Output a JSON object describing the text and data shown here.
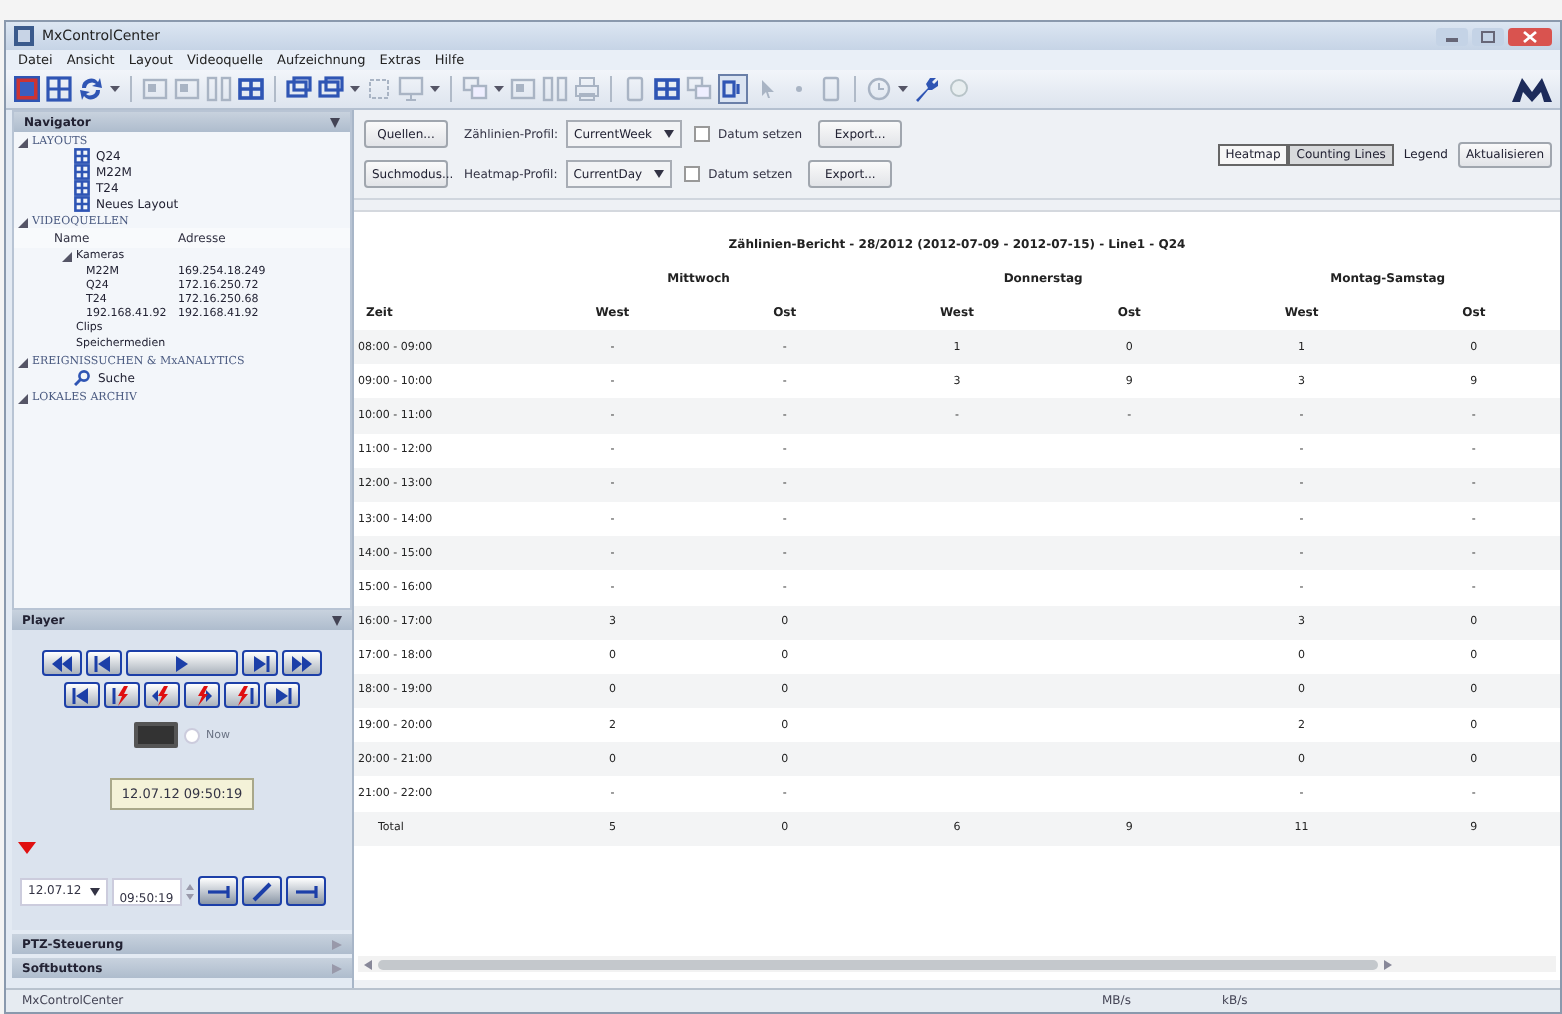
{
  "window": {
    "title": "MxControlCenter"
  },
  "menu": [
    "Datei",
    "Ansicht",
    "Layout",
    "Videoquelle",
    "Aufzeichnung",
    "Extras",
    "Hilfe"
  ],
  "navigator": {
    "title": "Navigator",
    "sections": [
      {
        "kind": "layouts",
        "label": "LAYOUTS",
        "expanded": true,
        "items": [
          "Q24",
          "M22M",
          "T24",
          "Neues Layout"
        ]
      },
      {
        "kind": "sources",
        "label": "VIDEOQUELLEN",
        "expanded": true,
        "columns": [
          "Name",
          "Adresse"
        ],
        "tree": [
          {
            "name": "Kameras",
            "expanded": true,
            "children": [
              {
                "name": "M22M",
                "address": "169.254.18.249"
              },
              {
                "name": "Q24",
                "address": "172.16.250.72"
              },
              {
                "name": "T24",
                "address": "172.16.250.68"
              },
              {
                "name": "192.168.41.92",
                "address": "192.168.41.92"
              }
            ]
          },
          {
            "name": "Clips"
          },
          {
            "name": "Speichermedien"
          }
        ]
      },
      {
        "kind": "search",
        "label": "EREIGNISSUCHEN & MxANALYTICS",
        "expanded": true,
        "items": [
          "Suche"
        ]
      },
      {
        "kind": "archive",
        "label": "LOKALES ARCHIV",
        "expanded": true
      }
    ]
  },
  "player": {
    "title": "Player",
    "now": {
      "label": "Now",
      "checked": false
    },
    "timestamp": "12.07.12 09:50:19",
    "date": "12.07.12",
    "time": "09:50:19"
  },
  "panels": [
    {
      "title": "PTZ-Steuerung",
      "expanded": false
    },
    {
      "title": "Softbuttons",
      "expanded": false
    }
  ],
  "report_controls": [
    {
      "button": "Quellen...",
      "profile_label": "Zählinien-Profil:",
      "profile": "CurrentWeek",
      "date_label": "Datum setzen",
      "date_checked": false,
      "export": "Export..."
    },
    {
      "button": "Suchmodus...",
      "profile_label": "Heatmap-Profil:",
      "profile": "CurrentDay",
      "date_label": "Datum setzen",
      "date_checked": false,
      "export": "Export..."
    }
  ],
  "view_tabs": [
    {
      "label": "Heatmap",
      "selected": false
    },
    {
      "label": "Counting Lines",
      "selected": true
    }
  ],
  "legend": "Legend",
  "refresh": "Aktualisieren",
  "report": {
    "title": "Zählinien-Bericht - 28/2012 (2012-07-09 - 2012-07-15) - Line1 - Q24",
    "days": [
      "Mittwoch",
      "Donnerstag",
      "Montag-Samstag"
    ],
    "columns": [
      "Zeit",
      "West",
      "Ost",
      "West",
      "Ost",
      "West",
      "Ost"
    ],
    "rows": [
      [
        "08:00 - 09:00",
        "-",
        "-",
        "1",
        "0",
        "1",
        "0"
      ],
      [
        "09:00 - 10:00",
        "-",
        "-",
        "3",
        "9",
        "3",
        "9"
      ],
      [
        "10:00 - 11:00",
        "-",
        "-",
        "-",
        "-",
        "-",
        "-"
      ],
      [
        "11:00 - 12:00",
        "-",
        "-",
        null,
        null,
        "-",
        "-"
      ],
      [
        "12:00 - 13:00",
        "-",
        "-",
        null,
        null,
        "-",
        "-"
      ],
      [
        "13:00 - 14:00",
        "-",
        "-",
        null,
        null,
        "-",
        "-"
      ],
      [
        "14:00 - 15:00",
        "-",
        "-",
        null,
        null,
        "-",
        "-"
      ],
      [
        "15:00 - 16:00",
        "-",
        "-",
        null,
        null,
        "-",
        "-"
      ],
      [
        "16:00 - 17:00",
        "3",
        "0",
        null,
        null,
        "3",
        "0"
      ],
      [
        "17:00 - 18:00",
        "0",
        "0",
        null,
        null,
        "0",
        "0"
      ],
      [
        "18:00 - 19:00",
        "0",
        "0",
        null,
        null,
        "0",
        "0"
      ],
      [
        "19:00 - 20:00",
        "2",
        "0",
        null,
        null,
        "2",
        "0"
      ],
      [
        "20:00 - 21:00",
        "0",
        "0",
        null,
        null,
        "0",
        "0"
      ],
      [
        "21:00 - 22:00",
        "-",
        "-",
        null,
        null,
        "-",
        "-"
      ],
      [
        "Total",
        "5",
        "0",
        "6",
        "9",
        "11",
        "9"
      ]
    ]
  },
  "status_bar": [
    "MxControlCenter",
    "MB/s",
    "kB/s"
  ]
}
